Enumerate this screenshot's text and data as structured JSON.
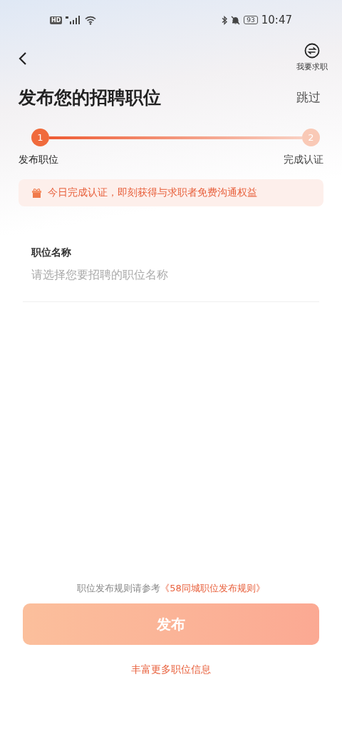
{
  "status_bar": {
    "hd": "HD",
    "battery": "93",
    "time": "10:47"
  },
  "header": {
    "switch_label": "我要求职",
    "title": "发布您的招聘职位",
    "skip": "跳过"
  },
  "steps": [
    {
      "number": "1",
      "label": "发布职位",
      "active": true
    },
    {
      "number": "2",
      "label": "完成认证",
      "active": false
    }
  ],
  "banner": {
    "text": "今日完成认证，即刻获得与求职者免费沟通权益"
  },
  "field": {
    "label": "职位名称",
    "placeholder": "请选择您要招聘的职位名称"
  },
  "rules": {
    "text": "职位发布规则请参考",
    "link": "《58同城职位发布规则》"
  },
  "submit": {
    "label": "发布",
    "disabled": true
  },
  "more_link": "丰富更多职位信息"
}
